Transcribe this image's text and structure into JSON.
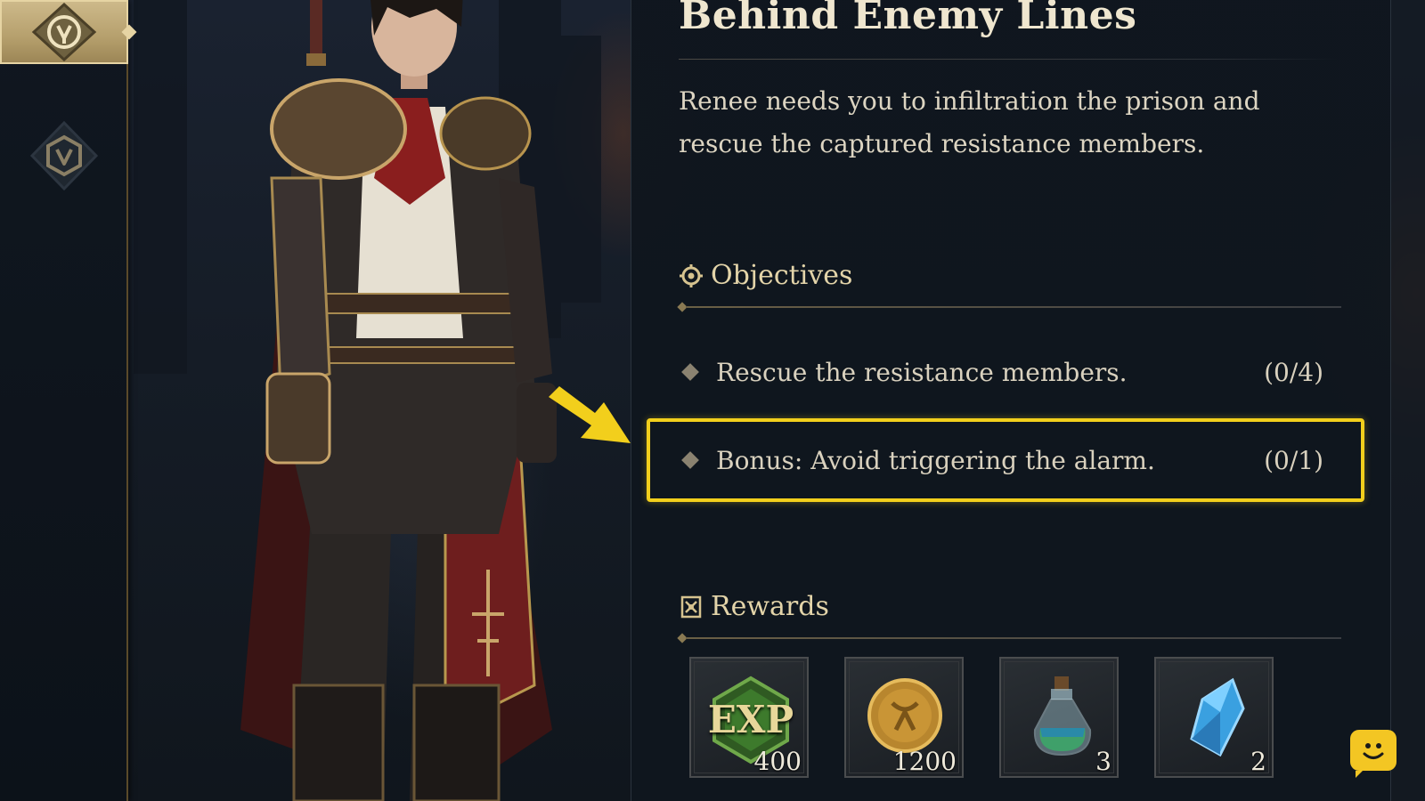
{
  "quest": {
    "title": "Behind Enemy Lines",
    "description": "Renee needs you to infiltration the prison and rescue the captured resistance members."
  },
  "objectives": {
    "heading": "Objectives",
    "items": [
      {
        "text": "Rescue the resistance members.",
        "count": "(0/4)"
      },
      {
        "text": "Bonus: Avoid triggering the alarm.",
        "count": "(0/1)"
      }
    ]
  },
  "rewards": {
    "heading": "Rewards",
    "items": [
      {
        "icon": "exp-icon",
        "label": "EXP",
        "quantity": "400"
      },
      {
        "icon": "gold-coin-icon",
        "quantity": "1200"
      },
      {
        "icon": "potion-icon",
        "quantity": "3"
      },
      {
        "icon": "crystal-icon",
        "quantity": "2"
      }
    ]
  },
  "colors": {
    "highlight": "#f2cf1c",
    "gold_text": "#e3d4a9",
    "panel_bg": "#0f161e"
  }
}
